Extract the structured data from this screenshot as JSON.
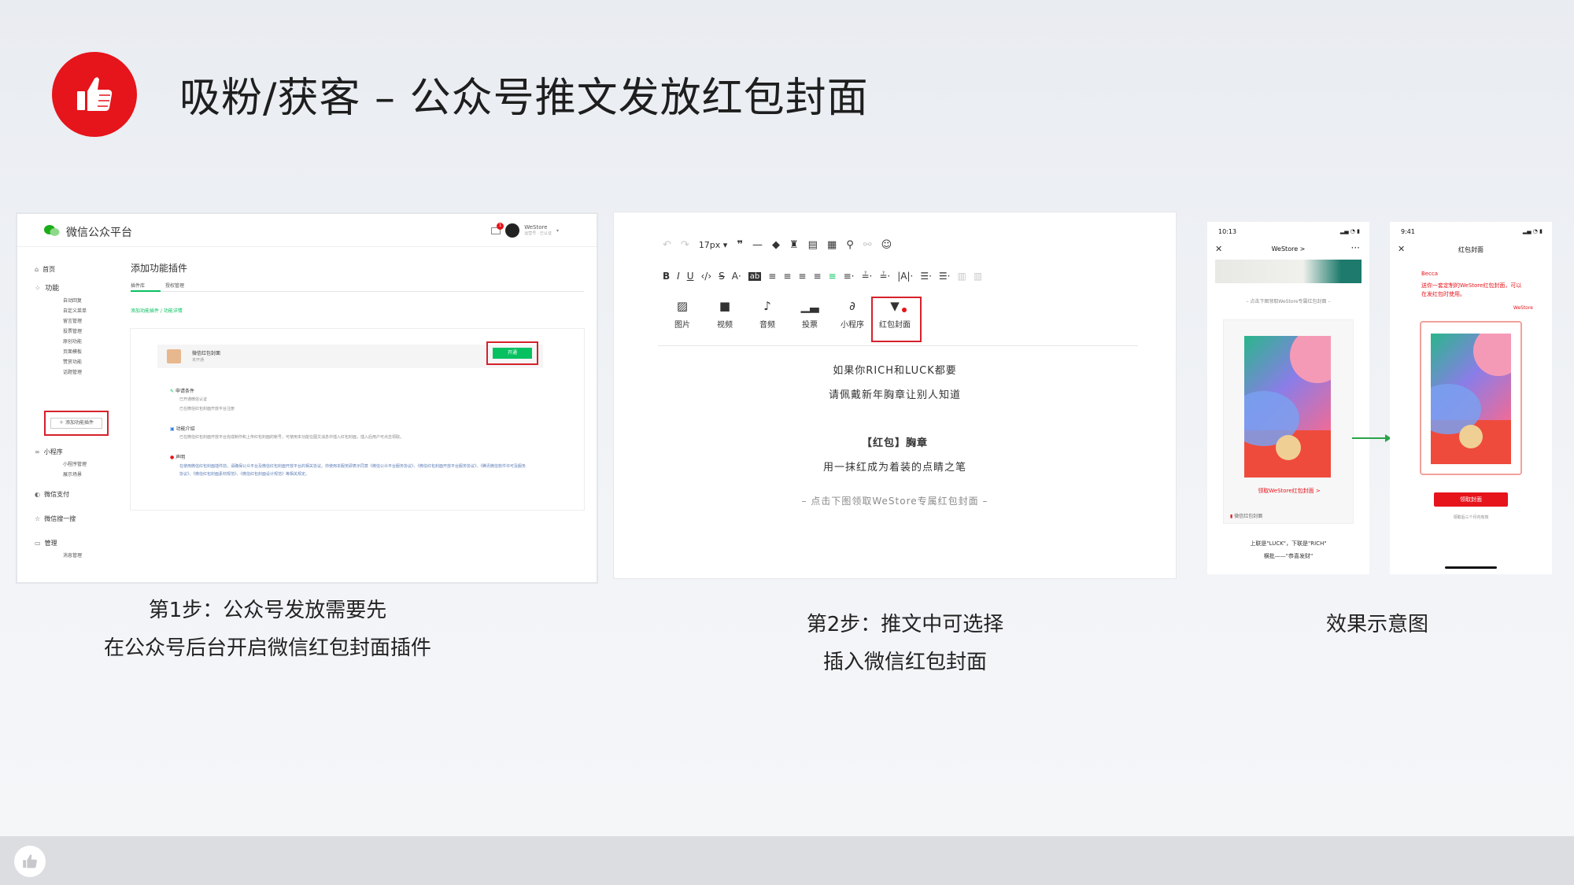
{
  "title": "吸粉/获客 – 公众号推文发放红包封面",
  "step1": {
    "brand": "微信公众平台",
    "user_name": "WeStore",
    "user_sub": "运营号 · 已认证",
    "notify_count": "1",
    "sidebar": [
      {
        "label": "首页",
        "type": "main"
      },
      {
        "label": "功能",
        "type": "main"
      },
      {
        "label": "自动回复",
        "type": "sub"
      },
      {
        "label": "自定义菜单",
        "type": "sub"
      },
      {
        "label": "留言管理",
        "type": "sub"
      },
      {
        "label": "投票管理",
        "type": "sub"
      },
      {
        "label": "原创功能",
        "type": "sub"
      },
      {
        "label": "页面模板",
        "type": "sub"
      },
      {
        "label": "赞赏功能",
        "type": "sub"
      },
      {
        "label": "话题管理",
        "type": "sub"
      }
    ],
    "add_plugin": "添加功能插件",
    "sidebar2": [
      {
        "label": "小程序",
        "type": "main"
      },
      {
        "label": "小程序管理",
        "type": "sub"
      },
      {
        "label": "展示场景",
        "type": "sub"
      },
      {
        "label": "微信支付",
        "type": "main"
      },
      {
        "label": "微信搜一搜",
        "type": "main"
      },
      {
        "label": "管理",
        "type": "main"
      },
      {
        "label": "消息管理",
        "type": "sub"
      }
    ],
    "content_title": "添加功能插件",
    "tabs": [
      "插件库",
      "授权管理"
    ],
    "breadcrumb": "添加功能插件 / 功能详情",
    "plugin_name": "微信红包封面",
    "plugin_status": "未开通",
    "open_label": "开通",
    "section_apply": "申请条件",
    "apply_items": [
      "已开通微信认证",
      "已在微信红包封面开放平台注册"
    ],
    "section_intro": "功能介绍",
    "intro_text": "已在微信红包封面开放平台完成制作和上传红包封面的帐号，可使用本功能在图文消息中插入红包封面，插入后用户可点击领取。",
    "section_notice": "声明",
    "notice_text": "在使用微信红包封面插件前，请确保公众平台及微信红包封面开放平台的相关协议。你使用本服务即表示同意《微信公众平台服务协议》、《微信红包封面开放平台服务协议》、《腾讯微信软件许可及服务协议》、《微信红包封面素材规范》、《微信红包封面设计规范》等相关规定。"
  },
  "step2": {
    "font_size": "17px",
    "insert_items": [
      "图片",
      "视频",
      "音频",
      "投票",
      "小程序",
      "红包封面"
    ],
    "article_lines": [
      "如果你RICH和LUCK都要",
      "请佩戴新年胸章让别人知道",
      "【红包】胸章",
      "用一抹红成为着装的点睛之笔",
      "– 点击下图领取WeStore专属红包封面 –"
    ]
  },
  "effect": {
    "phone1": {
      "time": "10:13",
      "nav_title": "WeStore >",
      "hint": "– 点击下图领取WeStore专属红包封面 –",
      "claim_link": "领取WeStore红包封面 >",
      "source": "微信红包封面",
      "footer1": "上联是\"LUCK\"，下联是\"RICH\"",
      "footer2": "横批——\"恭喜发财\""
    },
    "phone2": {
      "time": "9:41",
      "nav_title": "红包封面",
      "sender": "Becca",
      "message": "送你一套定制的WeStore红包封面，可以在发红包时使用。",
      "brand": "WeStore",
      "claim_button": "领取封面",
      "expire": "领取后三个月内有效"
    }
  },
  "captions": {
    "step1_line1": "第1步：公众号发放需要先",
    "step1_line2": "在公众号后台开启微信红包封面插件",
    "step2_line1": "第2步：推文中可选择",
    "step2_line2": "插入微信红包封面",
    "effect": "效果示意图"
  },
  "colors": {
    "brand_red": "#e6141b",
    "wechat_green": "#07c160",
    "highlight_red": "#d6212b"
  }
}
